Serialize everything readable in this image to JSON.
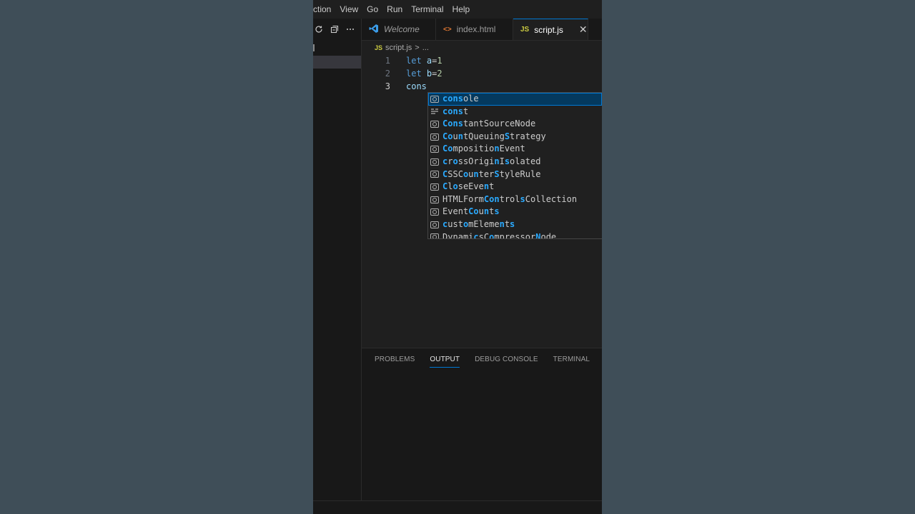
{
  "menu": [
    "ction",
    "View",
    "Go",
    "Run",
    "Terminal",
    "Help"
  ],
  "tabs": [
    {
      "icon": "vscode-logo",
      "label": "Welcome",
      "active": false
    },
    {
      "icon": "<>",
      "label": "index.html",
      "active": false
    },
    {
      "icon": "JS",
      "label": "script.js",
      "active": true,
      "close": "✕"
    }
  ],
  "breadcrumb": {
    "file": "script.js",
    "separator": ">",
    "rest": "..."
  },
  "editor": {
    "lines": [
      {
        "number": "1",
        "keyword": "let",
        "name": "a",
        "op": "=",
        "value": "1"
      },
      {
        "number": "2",
        "keyword": "let",
        "name": "b",
        "op": "=",
        "value": "2"
      },
      {
        "number": "3",
        "typed": "cons"
      }
    ]
  },
  "suggestions": [
    "console",
    "const",
    "ConstantSourceNode",
    "CountQueuingStrategy",
    "CompositionEvent",
    "crossOriginIsolated",
    "CSSCounterStyleRule",
    "CloseEvent",
    "HTMLFormControlsCollection",
    "EventCounts",
    "customElements",
    "DynamicsCompressorNode"
  ],
  "panel": {
    "tabs": [
      "PROBLEMS",
      "OUTPUT",
      "DEBUG CONSOLE",
      "TERMINAL"
    ],
    "active": "OUTPUT"
  },
  "colors": {
    "accent": "#0078d4",
    "keyword": "#569cd6",
    "match": "#2aaaff",
    "js": "#cbcb41",
    "html": "#e37933"
  }
}
